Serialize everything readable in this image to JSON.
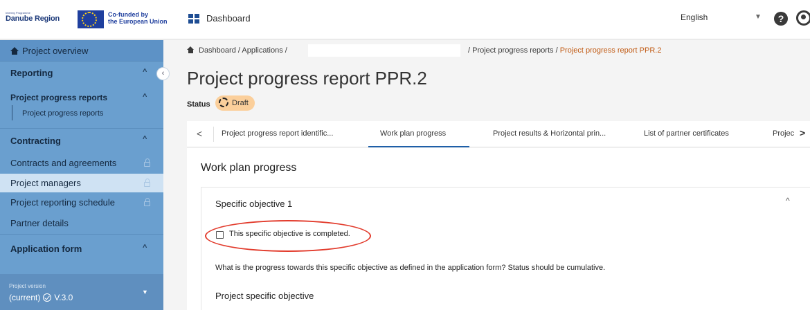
{
  "header": {
    "logo_programme": "Interreg Programme",
    "logo_name": "Danube Region",
    "cofund_line1": "Co-funded by",
    "cofund_line2": "the European Union",
    "dashboard_label": "Dashboard",
    "language": "English",
    "help_symbol": "?"
  },
  "sidebar": {
    "project_overview": "Project overview",
    "reporting": "Reporting",
    "project_progress_reports_group": "Project progress reports",
    "project_progress_reports_item": "Project progress reports",
    "contracting": "Contracting",
    "contracts_and_agreements": "Contracts and agreements",
    "project_managers": "Project managers",
    "project_reporting_schedule": "Project reporting schedule",
    "partner_details": "Partner details",
    "application_form": "Application form",
    "chevron_up": "^",
    "collapse_symbol": "‹",
    "version_label": "Project version",
    "version_current": "(current)",
    "version_value": "V.3.0"
  },
  "breadcrumb": {
    "dashboard": "Dashboard",
    "applications": "Applications",
    "sep": "/",
    "progress_reports": "Project progress reports",
    "current": "Project progress report PPR.2"
  },
  "page": {
    "title": "Project progress report PPR.2",
    "status_label": "Status",
    "status_value": "Draft"
  },
  "tabs": [
    "Project progress report identific...",
    "Work plan progress",
    "Project results & Horizontal prin...",
    "List of partner certificates",
    "Projec"
  ],
  "tab_nav": {
    "left": "<",
    "right": ">"
  },
  "content": {
    "section_title": "Work plan progress",
    "objective_title": "Specific objective 1",
    "objective_chevron": "^",
    "completed_checkbox_label": "This specific objective is completed.",
    "progress_question": "What is the progress towards this specific objective as defined in the application form? Status should be cumulative.",
    "project_specific_objective": "Project specific objective"
  },
  "colors": {
    "sidebar": "#6a9fcf",
    "sidebar_selected": "#cfe2f3",
    "accent_orange": "#c15a13",
    "status_badge": "#fbcf9b",
    "highlight_ring": "#e23b2c",
    "tab_active": "#1e5fa8"
  }
}
